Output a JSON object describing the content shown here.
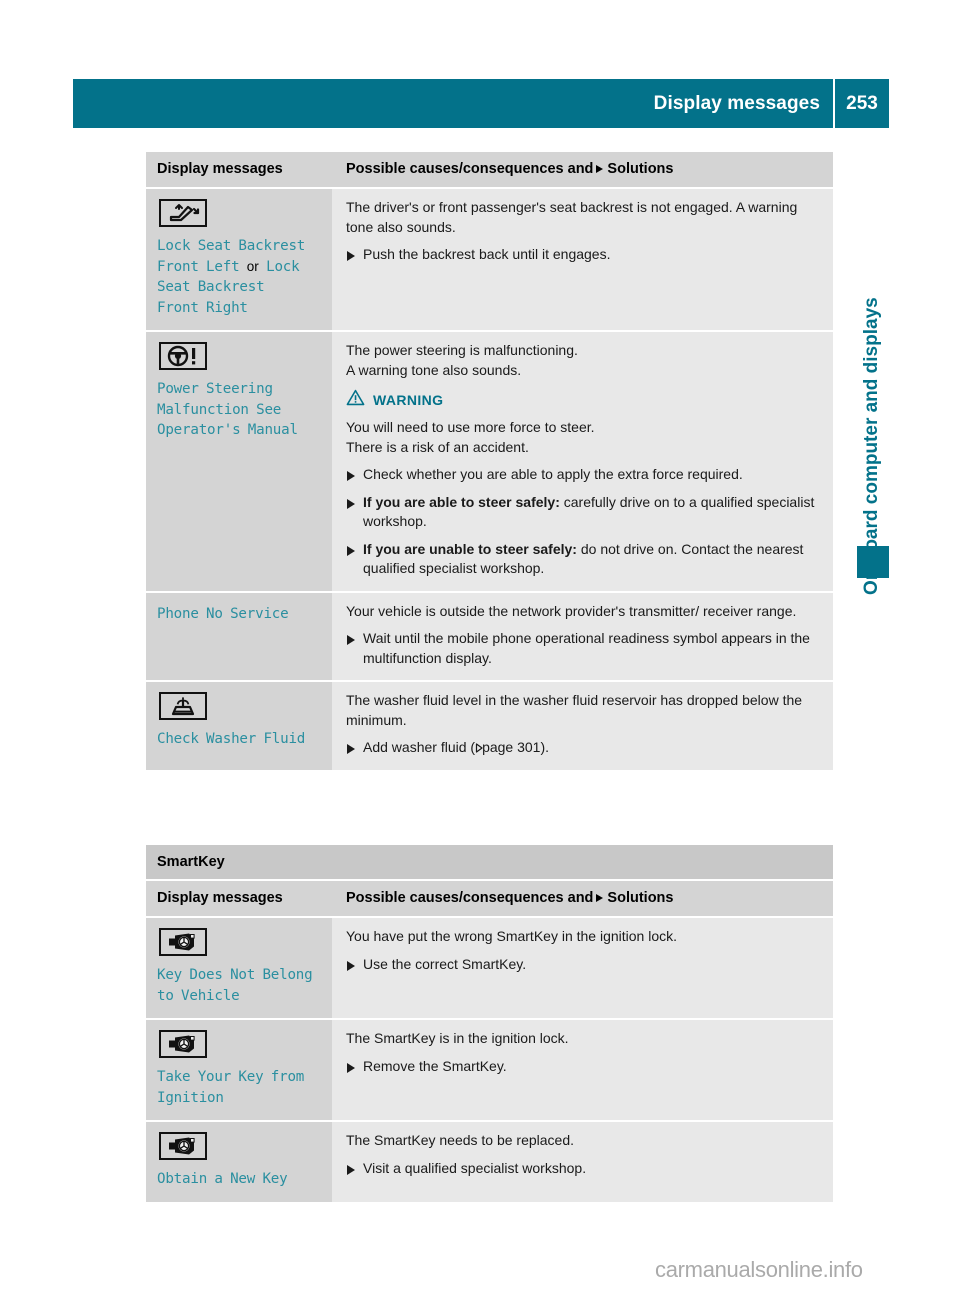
{
  "header": {
    "title": "Display messages",
    "page_number": "253",
    "accent_color": "#03728a"
  },
  "side_tab": {
    "label": "On-board computer and displays"
  },
  "footer": {
    "watermark": "carmanualsonline.info"
  },
  "column_headers": {
    "left": "Display messages",
    "right_prefix": "Possible causes/consequences and",
    "right_suffix": "Solutions"
  },
  "table1": {
    "rows": [
      {
        "icon": "seat-backrest-icon",
        "message_lines": [
          {
            "text": "Lock Seat Backrest",
            "style": "code"
          },
          {
            "text": "Front Left ",
            "style": "code"
          },
          {
            "text": "or",
            "style": "plain"
          },
          {
            "text": " Lock",
            "style": "code"
          },
          {
            "text": "Seat Backrest",
            "style": "code"
          },
          {
            "text": "Front Right",
            "style": "code"
          }
        ],
        "message_text": "Lock Seat Backrest Front Left or Lock Seat Backrest Front Right",
        "paragraphs": [
          "The driver's or front passenger's seat backrest is not engaged. A warning tone also sounds."
        ],
        "bullets": [
          {
            "bold": "",
            "text": "Push the backrest back until it engages."
          }
        ],
        "warning": null
      },
      {
        "icon": "power-steering-icon",
        "message_text": "Power Steering Malfunction See Operator's Manual",
        "paragraphs": [
          "The power steering is malfunctioning.",
          "A warning tone also sounds."
        ],
        "warning": {
          "label": "WARNING",
          "lines": [
            "You will need to use more force to steer.",
            "There is a risk of an accident."
          ]
        },
        "bullets": [
          {
            "bold": "",
            "text": "Check whether you are able to apply the extra force required."
          },
          {
            "bold": "If you are able to steer safely:",
            "text": " carefully drive on to a qualified specialist workshop."
          },
          {
            "bold": "If you are unable to steer safely:",
            "text": " do not drive on. Contact the nearest qualified specialist workshop."
          }
        ]
      },
      {
        "icon": null,
        "message_text": "Phone No Service",
        "paragraphs": [
          "Your vehicle is outside the network provider's transmitter/ receiver range."
        ],
        "bullets": [
          {
            "bold": "",
            "text": "Wait until the mobile phone operational readiness symbol appears in the multifunction display."
          }
        ],
        "warning": null
      },
      {
        "icon": "washer-fluid-icon",
        "message_text": "Check Washer Fluid",
        "paragraphs": [
          "The washer fluid level in the washer fluid reservoir has dropped below the minimum."
        ],
        "bullets": [
          {
            "bold": "",
            "text": "Add washer fluid (",
            "reference": "page 301",
            "suffix": ")."
          }
        ],
        "warning": null
      }
    ]
  },
  "table2": {
    "section_title": "SmartKey",
    "rows": [
      {
        "icon": "smartkey-icon",
        "message_text": "Key Does Not Belong to Vehicle",
        "paragraphs": [
          "You have put the wrong SmartKey in the ignition lock."
        ],
        "bullets": [
          {
            "bold": "",
            "text": "Use the correct SmartKey."
          }
        ]
      },
      {
        "icon": "smartkey-icon",
        "message_text": "Take Your Key from Ignition",
        "paragraphs": [
          "The SmartKey is in the ignition lock."
        ],
        "bullets": [
          {
            "bold": "",
            "text": "Remove the SmartKey."
          }
        ]
      },
      {
        "icon": "smartkey-icon",
        "message_text": "Obtain a New Key",
        "paragraphs": [
          "The SmartKey needs to be replaced."
        ],
        "bullets": [
          {
            "bold": "",
            "text": "Visit a qualified specialist workshop."
          }
        ]
      }
    ]
  }
}
